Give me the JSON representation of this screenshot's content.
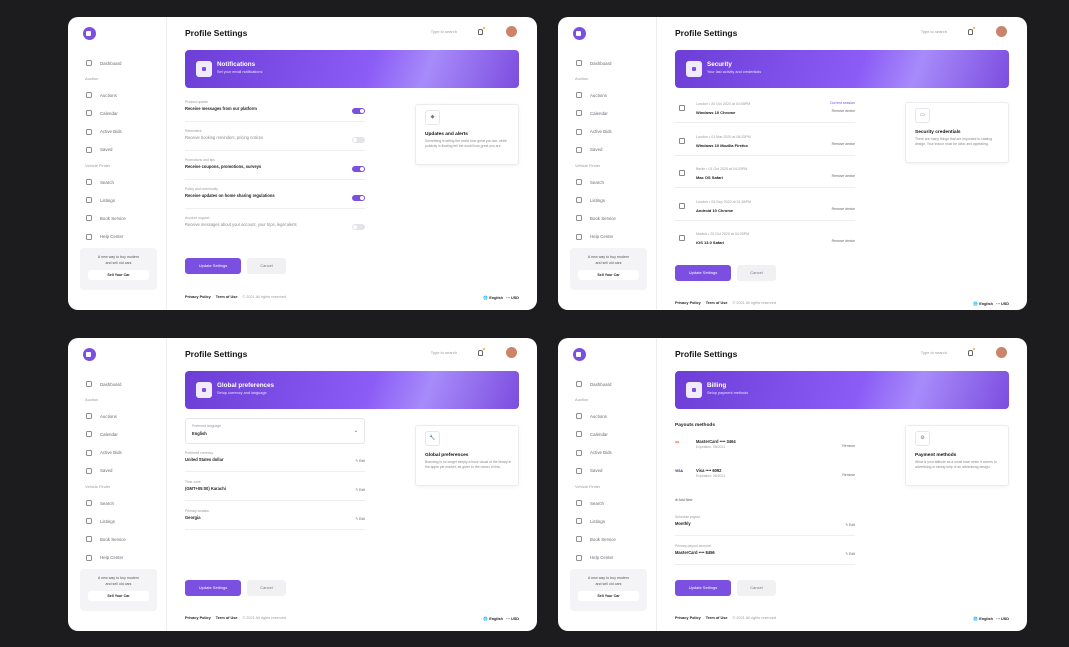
{
  "colors": {
    "accent": "#7b4fe0",
    "banner": "#8b5cf6"
  },
  "common": {
    "nav_dashboard": "Dashboard",
    "sec_auction": "Auction",
    "nav_auctions": "Auctions",
    "nav_calendar": "Calendar",
    "nav_active_bids": "Active Bids",
    "nav_saved": "Saved",
    "sec_vehicle": "Vehicle Finder",
    "nav_search": "Search",
    "nav_listings": "Listings",
    "nav_book_service": "Book Service",
    "nav_help": "Help Center",
    "promo_text": "A new way to buy modern and sell old cars",
    "promo_button": "Sell Your Car",
    "page_title": "Profile Settings",
    "search_placeholder": "Type to search",
    "update_btn": "Update Settings",
    "cancel_btn": "Cancel",
    "privacy": "Privacy Policy",
    "terms": "Term of Use",
    "copyright": "© 2021 All rights reserved",
    "lang": "English",
    "currency": "USD",
    "edit": "Edit",
    "remove": "Remove device",
    "remove_card": "Remove"
  },
  "notifications": {
    "banner_title": "Notifications",
    "banner_sub": "Set your email notifications",
    "rows": [
      {
        "label": "Product update",
        "text": "Receive messages from our platform",
        "on": true
      },
      {
        "label": "Reminders",
        "text": "Receive booking reminders, pricing notices",
        "on": false
      },
      {
        "label": "Promotions and tips",
        "text": "Receive coupons, promotions, surveys",
        "on": true
      },
      {
        "label": "Policy and community",
        "text": "Receive updates on home sharing regulations",
        "on": true
      },
      {
        "label": "Account support",
        "text": "Receive messages about your account, your trips, legal alerts",
        "on": false
      }
    ],
    "info_title": "Updates and alerts",
    "info_desc": "Something is telling the world how great you are, while publicity is floating tell the world how great you are."
  },
  "security": {
    "banner_title": "Security",
    "banner_sub": "Your last activity and credentials",
    "devices": [
      {
        "loc": "London  •  20 Oct 2020 at 04:05PM",
        "name": "Windows 10 Chrome",
        "current": "Current session"
      },
      {
        "loc": "London  •  01 Mar 2020 at 06:25PM",
        "name": "Windows 10 Mozilla Firefox",
        "current": ""
      },
      {
        "loc": "Berlin  •  01 Oct 2020 at 04:20PM",
        "name": "Mac OS Safari",
        "current": ""
      },
      {
        "loc": "London  •  05 Sep 2020 at 01:55PM",
        "name": "Android 10 Chrome",
        "current": ""
      },
      {
        "loc": "Madrid  •  20 Oct 2020 at 04:25PM",
        "name": "iOS 13.0 Safari",
        "current": ""
      }
    ],
    "info_title": "Security credentials",
    "info_desc": "There are many things that are important to catalog design. Your indoor must be clear and appealing."
  },
  "global": {
    "banner_title": "Global preferences",
    "banner_sub": "Setup currency and language",
    "select_label": "Preferred language",
    "select_value": "English",
    "fields": [
      {
        "label": "Preferred currency",
        "value": "United States dollar"
      },
      {
        "label": "Time zone",
        "value": "(GMT+05:00) Karachi"
      },
      {
        "label": "Primary location",
        "value": "Georgia"
      }
    ],
    "info_title": "Global preferences",
    "info_desc": "Branding is no longer simply a buzz visual of the library in the apple pie market, as given to the owner of this."
  },
  "billing": {
    "banner_title": "Billing",
    "banner_sub": "Setup payment methods",
    "section": "Payouts methods",
    "cards": [
      {
        "brand": "MasterCard",
        "name": "MasterCard •••• 3464",
        "exp": "Expiration: 08/2021"
      },
      {
        "brand": "VISA",
        "name": "Visa •••• 6092",
        "exp": "Expiration: 08/2021"
      }
    ],
    "add_new": "Add New",
    "fields": [
      {
        "label": "Schedule payout",
        "value": "Monthly"
      },
      {
        "label": "Primary payout account",
        "value": "MasterCard •••• 8456"
      }
    ],
    "info_title": "Payment methods",
    "info_desc": "What is your attitude as a small town when it comes to advertising or taking help of an advertising design."
  }
}
